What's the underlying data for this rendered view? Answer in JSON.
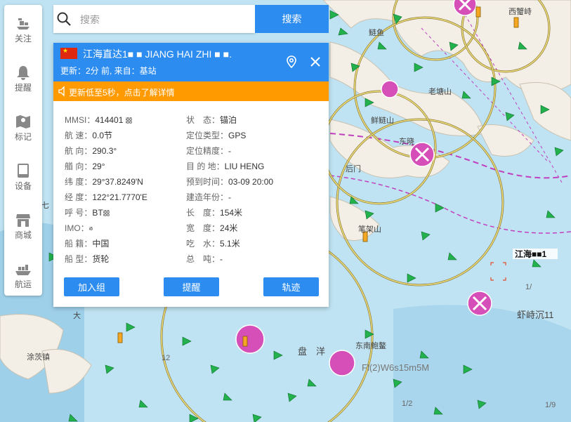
{
  "sidebar": {
    "items": [
      {
        "label": "关注",
        "icon": "ships-icon"
      },
      {
        "label": "提醒",
        "icon": "bell-icon"
      },
      {
        "label": "标记",
        "icon": "map-pin-icon"
      },
      {
        "label": "设备",
        "icon": "tablet-icon"
      },
      {
        "label": "商城",
        "icon": "store-icon"
      },
      {
        "label": "航运",
        "icon": "cargo-ship-icon"
      }
    ]
  },
  "search": {
    "placeholder": "搜索",
    "button": "搜索"
  },
  "ship": {
    "name": "江海直达1■ ■ JIANG HAI ZHI ■ ■.",
    "update": "更新：2分 前, 来自：基站",
    "notice": "更新低至5秒，点击了解详情",
    "left_rows": [
      {
        "key": "MMSI：",
        "value": "414401"
      },
      {
        "key": "航 速：",
        "value": "0.0节"
      },
      {
        "key": "航 向：",
        "value": "290.3°"
      },
      {
        "key": "艏 向：",
        "value": "29°"
      },
      {
        "key": "纬 度：",
        "value": "29°37.8249'N"
      },
      {
        "key": "经 度：",
        "value": "122°21.7770'E"
      },
      {
        "key": "呼 号：",
        "value": "BT"
      },
      {
        "key": "IMO：",
        "value": ""
      },
      {
        "key": "船 籍：",
        "value": "中国"
      },
      {
        "key": "船 型：",
        "value": "货轮"
      }
    ],
    "right_rows": [
      {
        "key": "状　态：",
        "value": "锚泊"
      },
      {
        "key": "定位类型：",
        "value": "GPS"
      },
      {
        "key": "定位精度：",
        "value": "-"
      },
      {
        "key": "目 的 地：",
        "value": "LIU HENG"
      },
      {
        "key": "预到时间：",
        "value": "03-09 20:00"
      },
      {
        "key": "建造年份：",
        "value": "-"
      },
      {
        "key": "长　度：",
        "value": "154米"
      },
      {
        "key": "宽　度：",
        "value": "24米"
      },
      {
        "key": "吃　水：",
        "value": "5.1米"
      },
      {
        "key": "总　吨：",
        "value": "-"
      }
    ],
    "buttons": {
      "add_group": "加入组",
      "remind": "提醒",
      "track": "轨迹"
    }
  },
  "map": {
    "labels": {
      "l1": "鲢鱼",
      "l2": "西蟹峙",
      "l3": "老塘山",
      "l4": "鲜鲢山",
      "l5": "东晓",
      "l6": "后门",
      "l7": "笔架山",
      "l8": "虾峙沉11",
      "l9": "大",
      "l10": "涂茨镇",
      "l11": "东南鲍鳌",
      "l12": "盘　洋",
      "l13": "Fl(2)W6s15m5M",
      "l14": "中七",
      "ship_tag": "江海■■1",
      "sm1": "1/",
      "sm2": "1/9",
      "sm3": "1/2",
      "sm4": "12"
    }
  },
  "colors": {
    "accent": "#2d8cf0",
    "notice": "#ff9a00",
    "water": "#bfe3f2",
    "land": "#f3efe6"
  }
}
